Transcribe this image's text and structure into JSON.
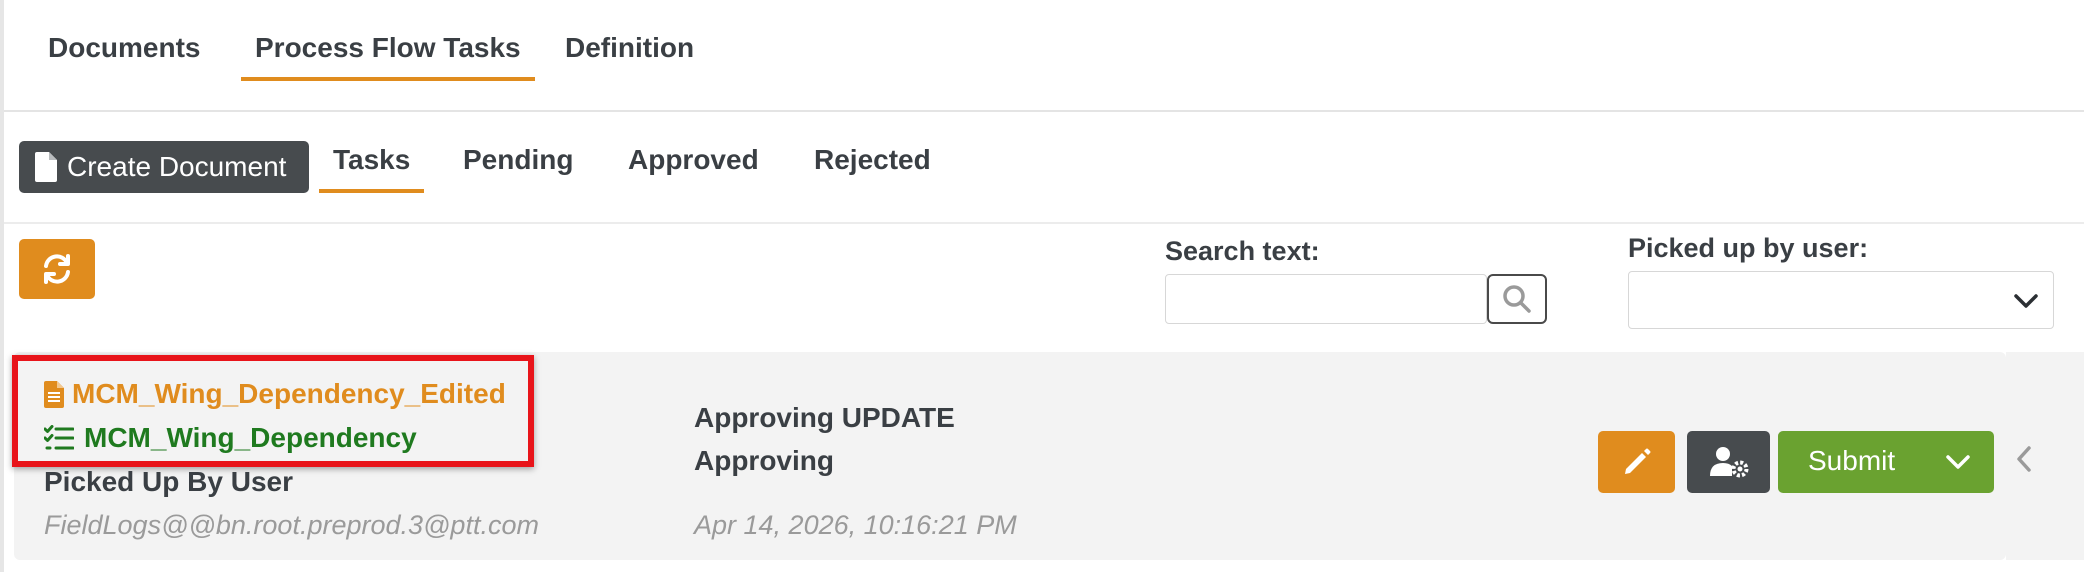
{
  "top_tabs": [
    {
      "label": "Documents",
      "active": false
    },
    {
      "label": "Process Flow Tasks",
      "active": true
    },
    {
      "label": "Definition",
      "active": false
    }
  ],
  "toolbar": {
    "create_label": "Create Document",
    "tabs": [
      {
        "label": "Tasks",
        "active": true
      },
      {
        "label": "Pending",
        "active": false
      },
      {
        "label": "Approved",
        "active": false
      },
      {
        "label": "Rejected",
        "active": false
      }
    ]
  },
  "filters": {
    "search_label": "Search text:",
    "search_value": "",
    "picked_label": "Picked up by user:",
    "picked_value": ""
  },
  "task": {
    "document_name": "MCM_Wing_Dependency_Edited",
    "task_name": "MCM_Wing_Dependency",
    "picked_label": "Picked Up By User",
    "picked_user": "FieldLogs@@bn.root.preprod.3@ptt.com",
    "status_title": "Approving UPDATE",
    "status_sub": "Approving",
    "timestamp": "Apr 14, 2026, 10:16:21 PM",
    "submit_label": "Submit"
  },
  "icons": {
    "create": "file-icon",
    "refresh": "refresh-icon",
    "search": "search-icon",
    "dropdown": "chevron-down-icon",
    "document": "file-text-icon",
    "task": "task-list-icon",
    "edit": "pencil-icon",
    "assign": "user-gear-icon",
    "collapse": "chevron-left-icon"
  },
  "colors": {
    "accent": "#e08c1e",
    "dark_button": "#474b4e",
    "submit": "#6aa230",
    "task_link": "#1f7a1f",
    "highlight": "#e8141a"
  }
}
